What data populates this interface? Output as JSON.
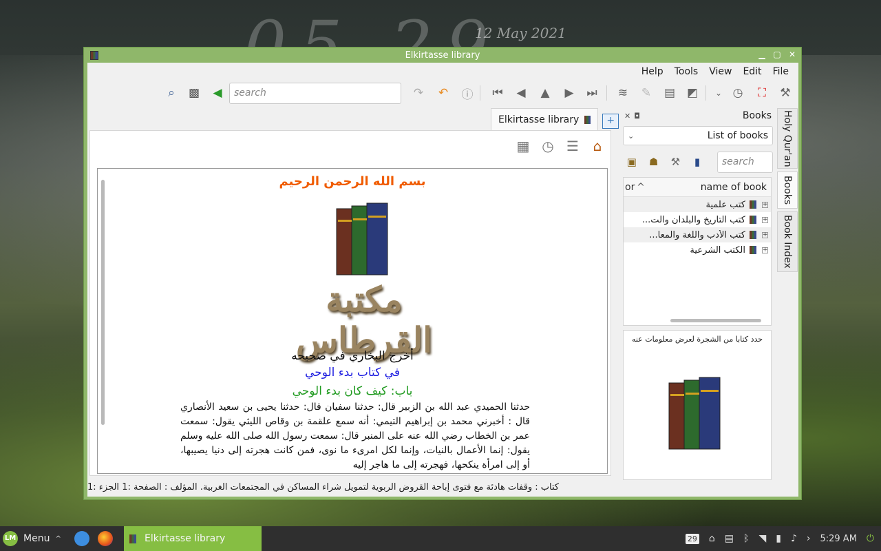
{
  "desktop": {
    "clock_digits": "05 29",
    "date_day": "12",
    "date_text": "May 2021"
  },
  "window": {
    "title": "Elkirtasse library",
    "controls": [
      "minimize",
      "maximize",
      "close"
    ]
  },
  "menubar": [
    "Help",
    "Tools",
    "View",
    "Edit",
    "File"
  ],
  "toolbar": {
    "search_placeholder": "search"
  },
  "tab": {
    "label": "Elkirtasse library"
  },
  "reader": {
    "bismillah": "بسم الله الرحمن الرحيم",
    "logo_text": "مكتبة القرطاس",
    "line1": "أخرج البخاري في صحيحه",
    "line2": "في كتاب بدء الوحي",
    "line3": "باب: كيف كان بدء الوحي",
    "hadith": "حدثنا الحميدي عبد الله بن الزبير قال: حدثنا سفيان قال: حدثنا يحيى بن سعيد الأنصاري قال : أخبرني محمد بن إبراهيم التيمي: أنه سمع علقمة بن وقاص الليثي يقول: سمعت عمر بن الخطاب رضي الله عنه على المنبر قال: سمعت رسول الله صلى الله عليه وسلم يقول: إنما الأعمال بالنيات، وإنما لكل امرىء ما نوى، فمن كانت هجرته إلى دنيا يصيبها، أو إلى امرأة ينكحها، فهجرته إلى ما هاجر إليه"
  },
  "books_panel": {
    "title": "Books",
    "combo_value": "List of books",
    "search_placeholder": "search",
    "col_or": "or",
    "col_name": "name of book",
    "items": [
      "كتب علمية",
      "كتب التاريخ والبلدان والت...",
      "كتب الأدب واللغة والمعا...",
      "الكتب الشرعية"
    ],
    "info_text": "حدد كتابا من الشجرة لعرض معلومات عنه"
  },
  "side_tabs": [
    "Holy Qur'an",
    "Books",
    "Book Index"
  ],
  "status": "كتاب : وقفات هادئة مع فتوى إباحة القروض الربوية لتمويل شراء المساكن في المجتمعات الغربية.  المؤلف : الصفحة :1  الجزء :1",
  "taskbar": {
    "menu_label": "Menu",
    "task_label": "Elkirtasse library",
    "calendar_day": "29",
    "time": "5:29 AM"
  }
}
